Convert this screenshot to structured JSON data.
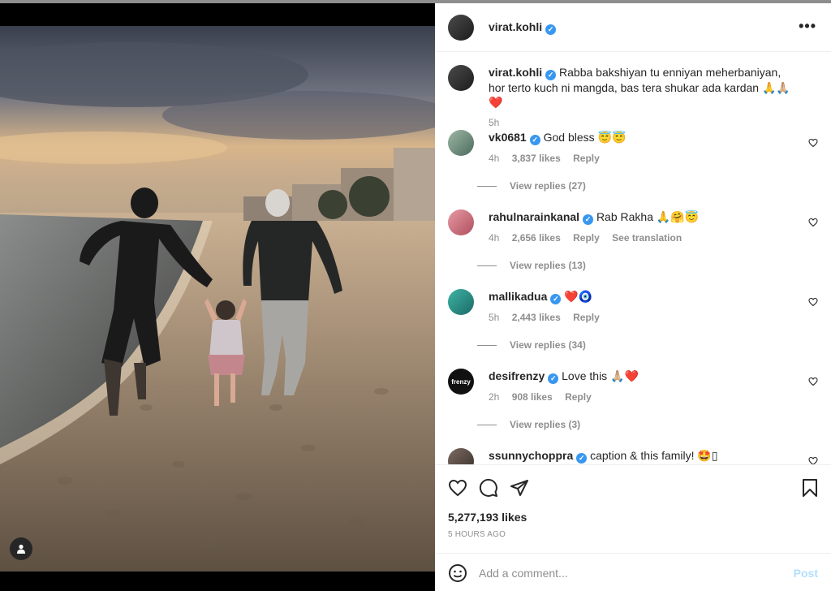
{
  "post": {
    "username": "virat.kohli",
    "caption": "Rabba bakshiyan tu enniyan meherbaniyan, hor terto kuch ni mangda, bas tera shukar ada kardan 🙏🙏🏼❤️",
    "caption_time": "5h",
    "likes": "5,277,193 likes",
    "time_ago": "5 HOURS AGO"
  },
  "comments": [
    {
      "username": "vk0681",
      "text": "God bless 😇😇",
      "time": "4h",
      "likes": "3,837 likes",
      "reply": "Reply",
      "translation": "",
      "view_replies": "View replies (27)"
    },
    {
      "username": "rahulnarainkanal",
      "text": "Rab Rakha 🙏🤗😇",
      "time": "4h",
      "likes": "2,656 likes",
      "reply": "Reply",
      "translation": "See translation",
      "view_replies": "View replies (13)"
    },
    {
      "username": "mallikadua",
      "text": "❤️🧿",
      "time": "5h",
      "likes": "2,443 likes",
      "reply": "Reply",
      "translation": "",
      "view_replies": "View replies (34)"
    },
    {
      "username": "desifrenzy",
      "text": "Love this 🙏🏼❤️",
      "time": "2h",
      "likes": "908 likes",
      "reply": "Reply",
      "translation": "",
      "view_replies": "View replies (3)"
    },
    {
      "username": "ssunnychoppra",
      "text": "caption & this family! 🤩▯",
      "time": "",
      "likes": "",
      "reply": "",
      "translation": "",
      "view_replies": ""
    }
  ],
  "comment_box": {
    "placeholder": "Add a comment...",
    "post_label": "Post"
  },
  "icons": {
    "more": "more-options-icon",
    "like": "heart-icon",
    "comment": "comment-icon",
    "share": "share-icon",
    "save": "bookmark-icon",
    "emoji": "emoji-icon",
    "user_tag": "user-tag-icon"
  },
  "colors": {
    "verified": "#3897f0",
    "post_disabled": "#b2dffc",
    "meta": "#8e8e8e"
  }
}
